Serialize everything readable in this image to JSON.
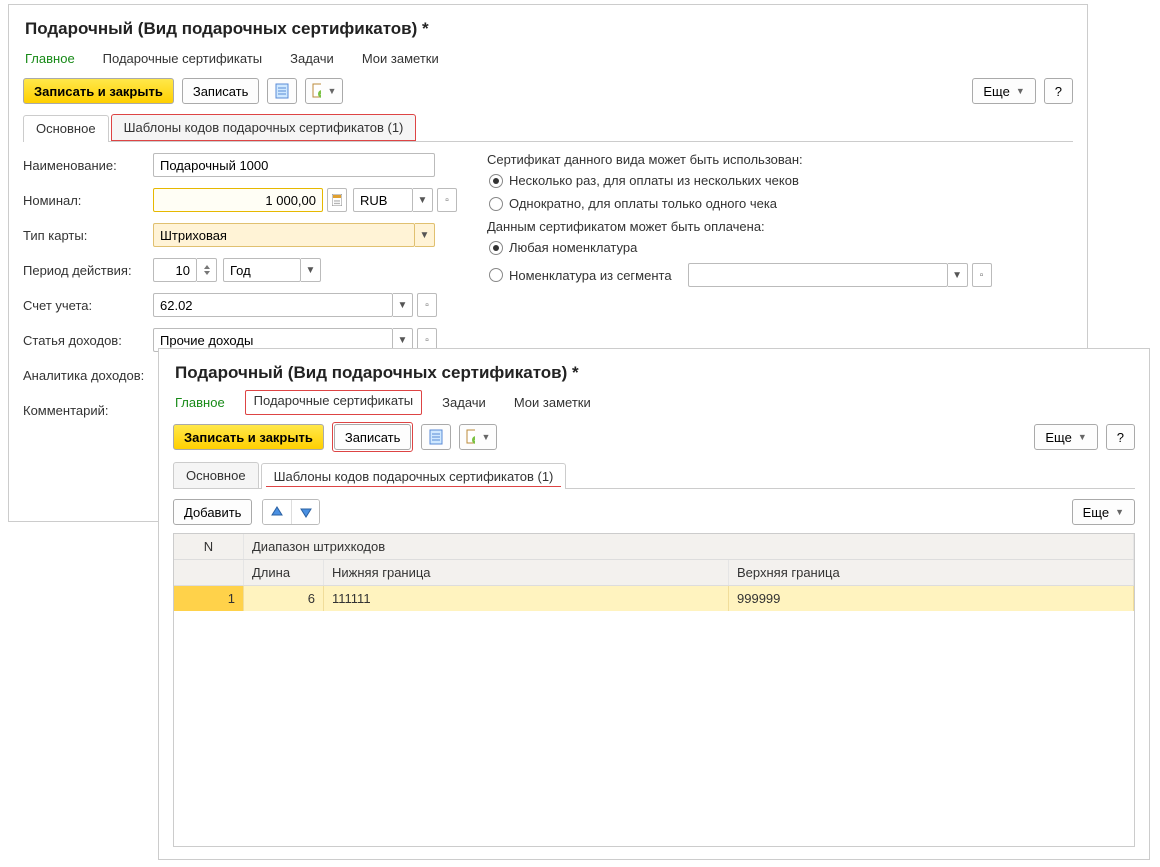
{
  "colors": {
    "accent_yellow": "#ffd000",
    "highlight_red": "#d44",
    "nav_green": "#178a17"
  },
  "winA": {
    "title": "Подарочный (Вид подарочных сертификатов) *",
    "nav": {
      "main": "Главное",
      "certs": "Подарочные сертификаты",
      "tasks": "Задачи",
      "notes": "Мои заметки"
    },
    "toolbar": {
      "save_close": "Записать и закрыть",
      "save": "Записать",
      "more": "Еще",
      "help": "?"
    },
    "subtabs": {
      "basic": "Основное",
      "templates": "Шаблоны кодов подарочных сертификатов (1)"
    },
    "labels": {
      "name": "Наименование:",
      "nominal": "Номинал:",
      "card_type": "Тип карты:",
      "period": "Период действия:",
      "account": "Счет учета:",
      "income_item": "Статья доходов:",
      "income_analytics": "Аналитика доходов:",
      "comment": "Комментарий:"
    },
    "values": {
      "name": "Подарочный 1000",
      "nominal": "1 000,00",
      "currency": "RUB",
      "card_type": "Штриховая",
      "period_num": "10",
      "period_unit": "Год",
      "account": "62.02",
      "income_item": "Прочие доходы"
    },
    "right": {
      "use_caption": "Сертификат данного вида может быть использован:",
      "use_opt1": "Несколько раз, для оплаты из нескольких чеков",
      "use_opt2": "Однократно, для оплаты только одного чека",
      "pay_caption": "Данным сертификатом может быть оплачена:",
      "pay_opt1": "Любая номенклатура",
      "pay_opt2": "Номенклатура из сегмента"
    }
  },
  "winB": {
    "title": "Подарочный (Вид подарочных сертификатов) *",
    "nav": {
      "main": "Главное",
      "certs": "Подарочные сертификаты",
      "tasks": "Задачи",
      "notes": "Мои заметки"
    },
    "toolbar": {
      "save_close": "Записать и закрыть",
      "save": "Записать",
      "more": "Еще",
      "help": "?"
    },
    "subtabs": {
      "basic": "Основное",
      "templates": "Шаблоны кодов подарочных сертификатов (1)"
    },
    "tabletb": {
      "add": "Добавить",
      "more": "Еще"
    },
    "grid": {
      "head_n": "N",
      "head_range": "Диапазон штрихкодов",
      "head_len": "Длина",
      "head_low": "Нижняя граница",
      "head_high": "Верхняя граница",
      "rows": [
        {
          "n": "1",
          "len": "6",
          "low": "111111",
          "high": "999999"
        }
      ]
    }
  }
}
